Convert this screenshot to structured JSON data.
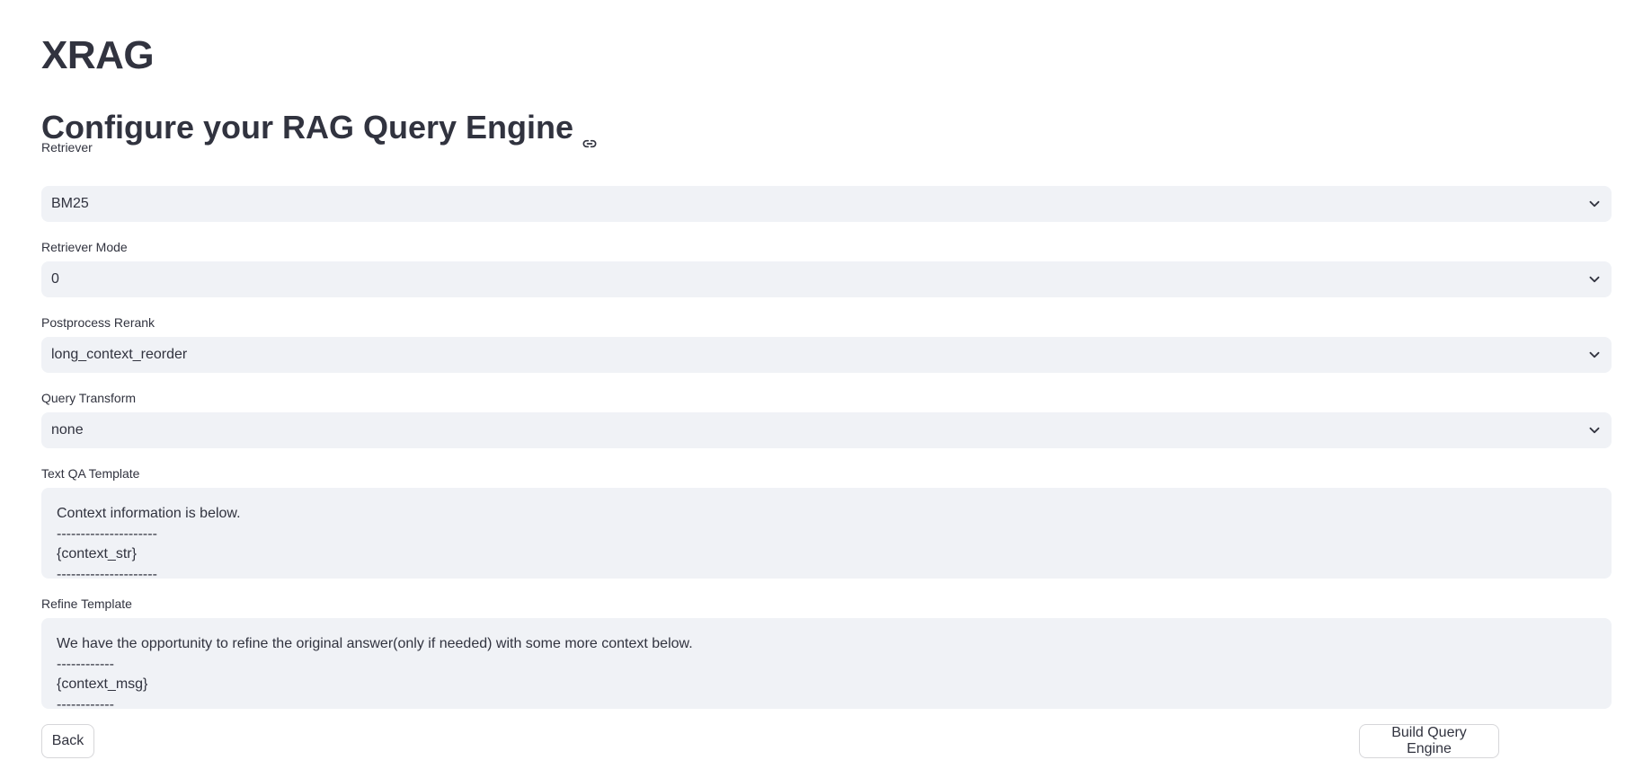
{
  "app": {
    "title": "XRAG"
  },
  "section": {
    "title": "Configure your RAG Query Engine",
    "anchor_icon": "link-icon"
  },
  "fields": {
    "retriever": {
      "label": "Retriever",
      "value": "BM25",
      "icon": "chevron-down-icon"
    },
    "retriever_mode": {
      "label": "Retriever Mode",
      "value": "0",
      "icon": "chevron-down-icon"
    },
    "postprocess_rerank": {
      "label": "Postprocess Rerank",
      "value": "long_context_reorder",
      "icon": "chevron-down-icon"
    },
    "query_transform": {
      "label": "Query Transform",
      "value": "none",
      "icon": "chevron-down-icon"
    },
    "text_qa_template": {
      "label": "Text QA Template",
      "lines": [
        "Context information is below.",
        "---------------------",
        "{context_str}",
        "---------------------"
      ]
    },
    "refine_template": {
      "label": "Refine Template",
      "lines": [
        "We have the opportunity to refine the original answer(only if needed) with some more context below.",
        "------------",
        "{context_msg}",
        "------------"
      ]
    }
  },
  "buttons": {
    "back": "Back",
    "build": "Build Query Engine"
  },
  "colors": {
    "text": "#31333f",
    "input_bg": "#f0f2f6",
    "button_border": "#d6d6d9"
  }
}
